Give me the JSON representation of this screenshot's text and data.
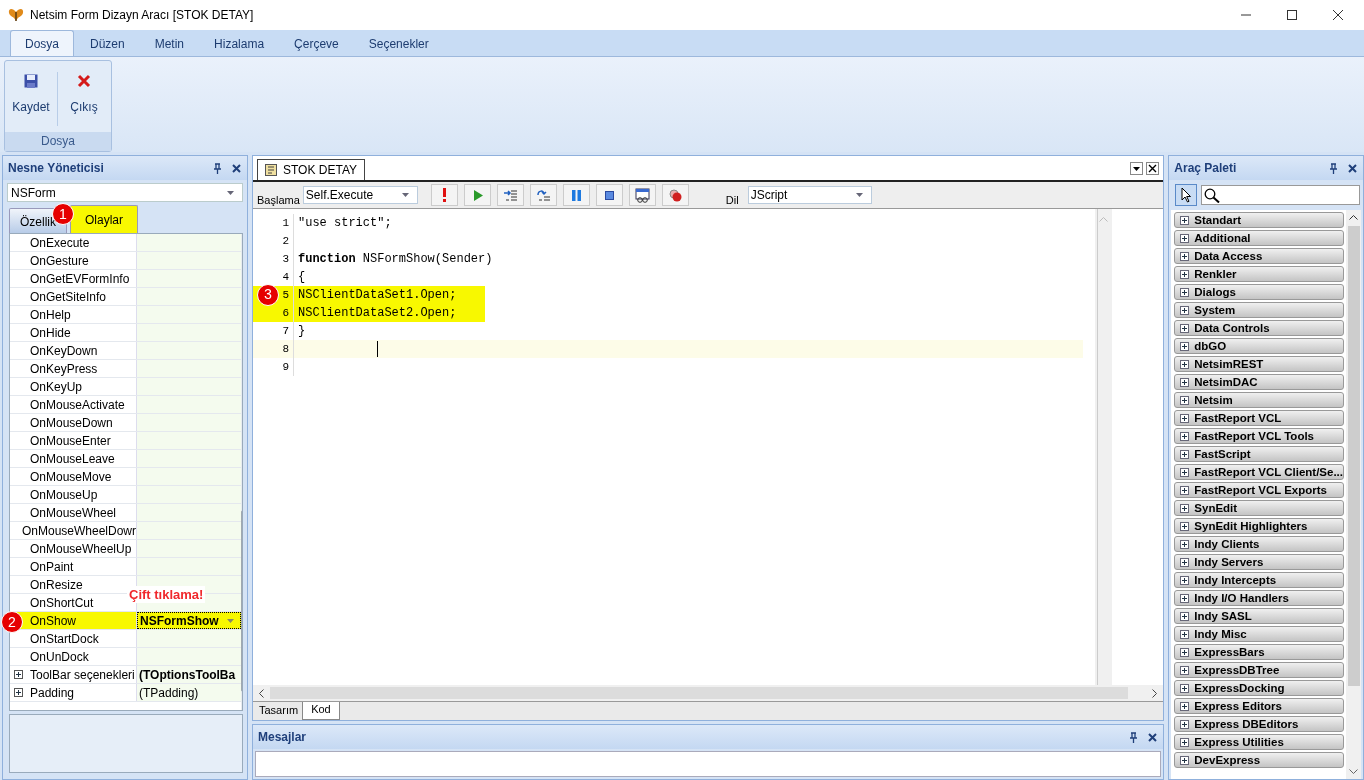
{
  "window": {
    "title": "Netsim Form Dizayn Aracı [STOK DETAY]"
  },
  "ribbon": {
    "tabs": [
      {
        "label": "Dosya",
        "selected": true
      },
      {
        "label": "Düzen",
        "selected": false
      },
      {
        "label": "Metin",
        "selected": false
      },
      {
        "label": "Hizalama",
        "selected": false
      },
      {
        "label": "Çerçeve",
        "selected": false
      },
      {
        "label": "Seçenekler",
        "selected": false
      }
    ],
    "group": {
      "label": "Dosya",
      "buttons": [
        {
          "kind": "save",
          "label": "Kaydet"
        },
        {
          "kind": "exit",
          "label": "Çıkış"
        }
      ]
    }
  },
  "object_inspector": {
    "title": "Nesne Yöneticisi",
    "object": "NSForm",
    "tabs": [
      {
        "label": "Özellik",
        "selected": false
      },
      {
        "label": "Olaylar",
        "selected": true,
        "highlighted": true
      }
    ],
    "rows": [
      {
        "name": "OnExecute"
      },
      {
        "name": "OnGesture"
      },
      {
        "name": "OnGetEVFormInfo"
      },
      {
        "name": "OnGetSiteInfo"
      },
      {
        "name": "OnHelp"
      },
      {
        "name": "OnHide"
      },
      {
        "name": "OnKeyDown"
      },
      {
        "name": "OnKeyPress"
      },
      {
        "name": "OnKeyUp"
      },
      {
        "name": "OnMouseActivate"
      },
      {
        "name": "OnMouseDown"
      },
      {
        "name": "OnMouseEnter"
      },
      {
        "name": "OnMouseLeave"
      },
      {
        "name": "OnMouseMove"
      },
      {
        "name": "OnMouseUp"
      },
      {
        "name": "OnMouseWheel"
      },
      {
        "name": "OnMouseWheelDowr"
      },
      {
        "name": "OnMouseWheelUp"
      },
      {
        "name": "OnPaint"
      },
      {
        "name": "OnResize"
      },
      {
        "name": "OnShortCut"
      },
      {
        "name": "OnShow",
        "value": "NSFormShow",
        "selected": true,
        "badge": "2"
      },
      {
        "name": "OnStartDock"
      },
      {
        "name": "OnUnDock"
      },
      {
        "name": "ToolBar seçenekleri",
        "value": "(TOptionsToolBa",
        "expandable": true,
        "bold_value": true
      },
      {
        "name": "Padding",
        "value": "(TPadding)",
        "expandable": true
      }
    ]
  },
  "annotations": [
    {
      "text": "1"
    },
    {
      "text": "Çift tıklama!"
    },
    {
      "text": "3"
    }
  ],
  "editor": {
    "tab": "STOK DETAY",
    "start_label": "Başlama",
    "start_value": "Self.Execute",
    "lang_label": "Dil",
    "lang_value": "JScript",
    "lines": [
      {
        "number": "1",
        "code": "\"use strict\";"
      },
      {
        "number": "2"
      },
      {
        "number": "3",
        "code": "**function** NSFormShow(Sender)"
      },
      {
        "number": "4",
        "code": "{"
      },
      {
        "number": "5",
        "code": "NSClientDataSet1.Open;",
        "highlighted": true
      },
      {
        "number": "6",
        "code": "NSClientDataSet2.Open;",
        "highlighted": true
      },
      {
        "number": "7",
        "code": "}"
      },
      {
        "number": "8",
        "current": true
      },
      {
        "number": "9"
      }
    ],
    "bottom_tabs": [
      {
        "label": "Tasarım",
        "selected": false
      },
      {
        "label": "Kod",
        "selected": true
      }
    ]
  },
  "messages": {
    "title": "Mesajlar"
  },
  "palette": {
    "title": "Araç Paleti",
    "categories": [
      "Standart",
      "Additional",
      "Data Access",
      "Renkler",
      "Dialogs",
      "System",
      "Data Controls",
      "dbGO",
      "NetsimREST",
      "NetsimDAC",
      "Netsim",
      "FastReport VCL",
      "FastReport VCL Tools",
      "FastScript",
      "FastReport VCL Client/Se...",
      "FastReport VCL Exports",
      "SynEdit",
      "SynEdit Highlighters",
      "Indy Clients",
      "Indy Servers",
      "Indy Intercepts",
      "Indy I/O Handlers",
      "Indy SASL",
      "Indy Misc",
      "ExpressBars",
      "ExpressDBTree",
      "ExpressDocking",
      "Express Editors",
      "Express DBEditors",
      "Express Utilities",
      "DevExpress"
    ]
  }
}
